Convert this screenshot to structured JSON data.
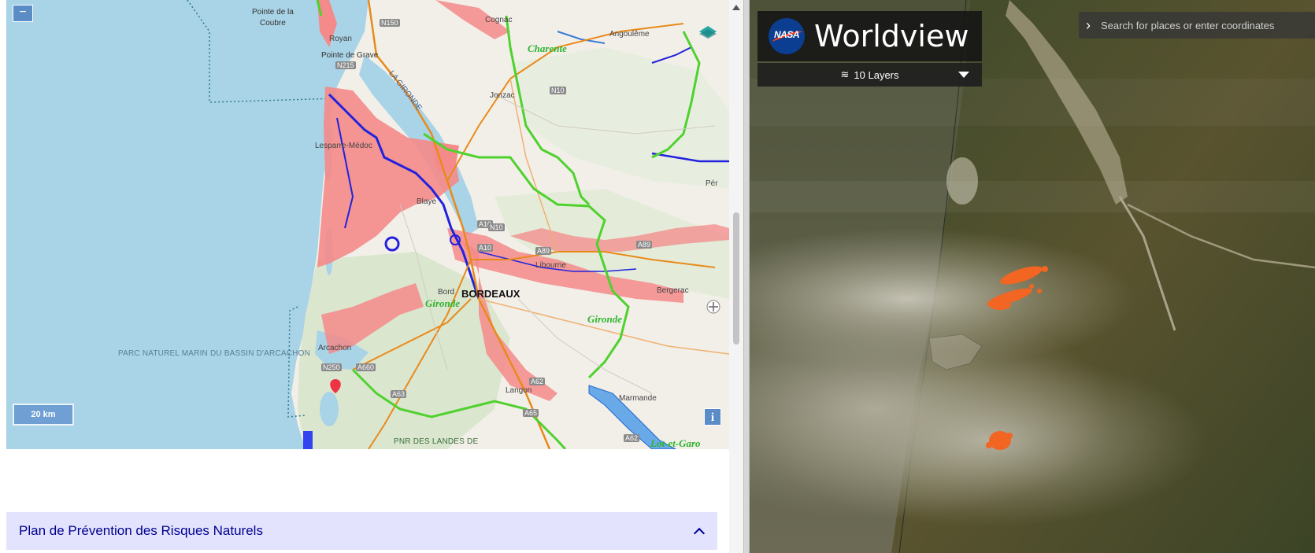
{
  "left": {
    "zoom_out_label": "−",
    "scale_label": "20 km",
    "info_label": "i",
    "accordion_title": "Plan de Prévention des Risques Naturels",
    "map_labels": {
      "pointe_coubre_1": "Pointe de la",
      "pointe_coubre_2": "Coubre",
      "royan": "Royan",
      "pointe_grave": "Pointe de Grave",
      "charente": "Charente",
      "angouleme": "Angoulême",
      "cognac": "Cognac",
      "jonzac": "Jonzac",
      "lesparre": "Lesparre-Médoc",
      "la_gironde": "LA GIRONDE",
      "blaye": "Blaye",
      "libourne": "Libourne",
      "bordeaux": "BORDEAUX",
      "bordeaux_small": "Bord",
      "gironde_1": "Gironde",
      "gironde_2": "Gironde",
      "bergerac": "Bergerac",
      "per": "Pér",
      "arcachon": "Arcachon",
      "parc_marin": "PARC NATUREL MARIN DU BASSIN D'ARCACHON",
      "langon": "Langon",
      "marmande": "Marmande",
      "pnr_landes": "PNR DES LANDES DE",
      "lot_garonne": "Lot-et-Garo",
      "a10": "A10",
      "a10b": "A10",
      "a89": "A89",
      "a89b": "A89",
      "a63": "A63",
      "a65": "A65",
      "a62": "A62",
      "a62b": "A62",
      "a660": "A660",
      "n250": "N250",
      "n10": "N10",
      "n10b": "N10",
      "n150": "N150",
      "n215": "N215"
    }
  },
  "right": {
    "app_title": "Worldview",
    "logo_text": "NASA",
    "layers_label": "10 Layers",
    "layers_icon": "stack-icon",
    "search_placeholder": "Search for places or enter coordinates"
  },
  "colors": {
    "accordion_bg": "#e3e3fd",
    "accordion_text": "#000091",
    "flood_zone": "#f48a8a",
    "sea": "#a9d3e6",
    "fire": "#f26522"
  }
}
